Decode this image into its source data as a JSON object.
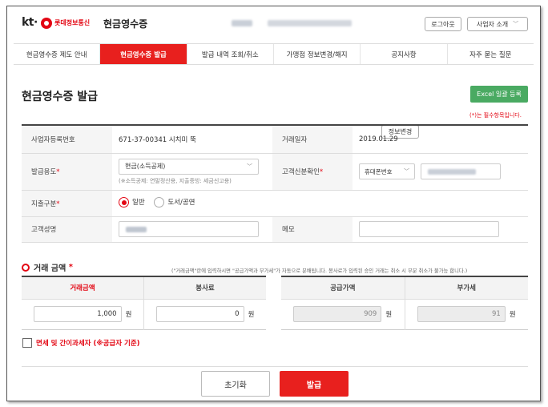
{
  "header": {
    "logo_kt": "kt·",
    "logo_sub": "롯데정보통신",
    "title": "현금영수증",
    "buttons": {
      "info_change": "정보변경",
      "logout": "로그아웃",
      "business_intro": "사업자 소개"
    }
  },
  "nav": {
    "tabs": [
      {
        "label": "현금영수증 제도 안내",
        "active": false
      },
      {
        "label": "현금영수증 발급",
        "active": true
      },
      {
        "label": "발급 내역 조회/취소",
        "active": false
      },
      {
        "label": "가맹점 정보변경/해지",
        "active": false
      },
      {
        "label": "공지사항",
        "active": false
      },
      {
        "label": "자주 묻는 질문",
        "active": false
      }
    ]
  },
  "page": {
    "title": "현금영수증 발급",
    "excel_button": "Excel 일괄 등록",
    "required_note": "(*)는 필수항목입니다."
  },
  "form": {
    "biz_no_label": "사업자등록번호",
    "biz_no_value": "671-37-00341  시치미 뚝",
    "trade_date_label": "거래일자",
    "trade_date_value": "2019.01.29",
    "purpose_label": "발급용도",
    "purpose_value": "현금(소득공제)",
    "purpose_hint": "(※소득공제: 연말정산용, 지출증빙: 세금신고용)",
    "customer_id_label": "고객신분확인",
    "customer_id_type": "휴대폰번호",
    "expense_label": "지출구분",
    "expense_options": [
      "일반",
      "도서/공연"
    ],
    "customer_name_label": "고객성명",
    "memo_label": "메모",
    "required_mark": "*"
  },
  "amount": {
    "section_title": "거래 금액",
    "required_mark": "*",
    "note": "(\"거래금액\"란에 입력하시면 \"공급가액과 부가세\"가 자동으로 분배됩니다. 봉사료가 입력된 승인 거래는 취소 시 부분 취소가 불가능 합니다.)",
    "headers": {
      "trade": "거래금액",
      "service": "봉사료",
      "supply": "공급가액",
      "vat": "부가세"
    },
    "values": {
      "trade": "1,000",
      "service": "0",
      "supply": "909",
      "vat": "91"
    },
    "unit": "원"
  },
  "tax_exempt_label": "면세 및 간이과세자 (※공급자 기준)",
  "actions": {
    "reset": "초기화",
    "issue": "발급"
  },
  "colors": {
    "accent_red": "#e8201e",
    "excel_green": "#4aaa62"
  }
}
